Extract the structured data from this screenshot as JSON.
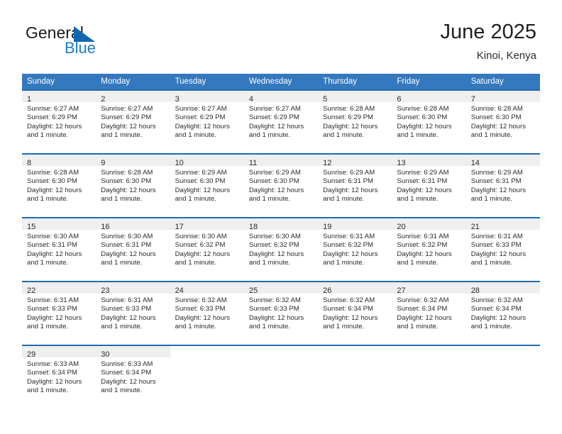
{
  "logo": {
    "word_one": "General",
    "word_two": "Blue",
    "triangle_icon": "triangle-icon",
    "blue_color": "#1f7ac4"
  },
  "header": {
    "title": "June 2025",
    "location": "Kinoi, Kenya"
  },
  "theme": {
    "header_blue": "#3478bd",
    "border_blue": "#1f6cb0",
    "daynum_bg": "#efefef"
  },
  "calendar": {
    "weekday_headers": [
      "Sunday",
      "Monday",
      "Tuesday",
      "Wednesday",
      "Thursday",
      "Friday",
      "Saturday"
    ],
    "weeks": [
      [
        {
          "day": "1",
          "sunrise": "Sunrise: 6:27 AM",
          "sunset": "Sunset: 6:29 PM",
          "daylight": "Daylight: 12 hours and 1 minute."
        },
        {
          "day": "2",
          "sunrise": "Sunrise: 6:27 AM",
          "sunset": "Sunset: 6:29 PM",
          "daylight": "Daylight: 12 hours and 1 minute."
        },
        {
          "day": "3",
          "sunrise": "Sunrise: 6:27 AM",
          "sunset": "Sunset: 6:29 PM",
          "daylight": "Daylight: 12 hours and 1 minute."
        },
        {
          "day": "4",
          "sunrise": "Sunrise: 6:27 AM",
          "sunset": "Sunset: 6:29 PM",
          "daylight": "Daylight: 12 hours and 1 minute."
        },
        {
          "day": "5",
          "sunrise": "Sunrise: 6:28 AM",
          "sunset": "Sunset: 6:29 PM",
          "daylight": "Daylight: 12 hours and 1 minute."
        },
        {
          "day": "6",
          "sunrise": "Sunrise: 6:28 AM",
          "sunset": "Sunset: 6:30 PM",
          "daylight": "Daylight: 12 hours and 1 minute."
        },
        {
          "day": "7",
          "sunrise": "Sunrise: 6:28 AM",
          "sunset": "Sunset: 6:30 PM",
          "daylight": "Daylight: 12 hours and 1 minute."
        }
      ],
      [
        {
          "day": "8",
          "sunrise": "Sunrise: 6:28 AM",
          "sunset": "Sunset: 6:30 PM",
          "daylight": "Daylight: 12 hours and 1 minute."
        },
        {
          "day": "9",
          "sunrise": "Sunrise: 6:28 AM",
          "sunset": "Sunset: 6:30 PM",
          "daylight": "Daylight: 12 hours and 1 minute."
        },
        {
          "day": "10",
          "sunrise": "Sunrise: 6:29 AM",
          "sunset": "Sunset: 6:30 PM",
          "daylight": "Daylight: 12 hours and 1 minute."
        },
        {
          "day": "11",
          "sunrise": "Sunrise: 6:29 AM",
          "sunset": "Sunset: 6:30 PM",
          "daylight": "Daylight: 12 hours and 1 minute."
        },
        {
          "day": "12",
          "sunrise": "Sunrise: 6:29 AM",
          "sunset": "Sunset: 6:31 PM",
          "daylight": "Daylight: 12 hours and 1 minute."
        },
        {
          "day": "13",
          "sunrise": "Sunrise: 6:29 AM",
          "sunset": "Sunset: 6:31 PM",
          "daylight": "Daylight: 12 hours and 1 minute."
        },
        {
          "day": "14",
          "sunrise": "Sunrise: 6:29 AM",
          "sunset": "Sunset: 6:31 PM",
          "daylight": "Daylight: 12 hours and 1 minute."
        }
      ],
      [
        {
          "day": "15",
          "sunrise": "Sunrise: 6:30 AM",
          "sunset": "Sunset: 6:31 PM",
          "daylight": "Daylight: 12 hours and 1 minute."
        },
        {
          "day": "16",
          "sunrise": "Sunrise: 6:30 AM",
          "sunset": "Sunset: 6:31 PM",
          "daylight": "Daylight: 12 hours and 1 minute."
        },
        {
          "day": "17",
          "sunrise": "Sunrise: 6:30 AM",
          "sunset": "Sunset: 6:32 PM",
          "daylight": "Daylight: 12 hours and 1 minute."
        },
        {
          "day": "18",
          "sunrise": "Sunrise: 6:30 AM",
          "sunset": "Sunset: 6:32 PM",
          "daylight": "Daylight: 12 hours and 1 minute."
        },
        {
          "day": "19",
          "sunrise": "Sunrise: 6:31 AM",
          "sunset": "Sunset: 6:32 PM",
          "daylight": "Daylight: 12 hours and 1 minute."
        },
        {
          "day": "20",
          "sunrise": "Sunrise: 6:31 AM",
          "sunset": "Sunset: 6:32 PM",
          "daylight": "Daylight: 12 hours and 1 minute."
        },
        {
          "day": "21",
          "sunrise": "Sunrise: 6:31 AM",
          "sunset": "Sunset: 6:33 PM",
          "daylight": "Daylight: 12 hours and 1 minute."
        }
      ],
      [
        {
          "day": "22",
          "sunrise": "Sunrise: 6:31 AM",
          "sunset": "Sunset: 6:33 PM",
          "daylight": "Daylight: 12 hours and 1 minute."
        },
        {
          "day": "23",
          "sunrise": "Sunrise: 6:31 AM",
          "sunset": "Sunset: 6:33 PM",
          "daylight": "Daylight: 12 hours and 1 minute."
        },
        {
          "day": "24",
          "sunrise": "Sunrise: 6:32 AM",
          "sunset": "Sunset: 6:33 PM",
          "daylight": "Daylight: 12 hours and 1 minute."
        },
        {
          "day": "25",
          "sunrise": "Sunrise: 6:32 AM",
          "sunset": "Sunset: 6:33 PM",
          "daylight": "Daylight: 12 hours and 1 minute."
        },
        {
          "day": "26",
          "sunrise": "Sunrise: 6:32 AM",
          "sunset": "Sunset: 6:34 PM",
          "daylight": "Daylight: 12 hours and 1 minute."
        },
        {
          "day": "27",
          "sunrise": "Sunrise: 6:32 AM",
          "sunset": "Sunset: 6:34 PM",
          "daylight": "Daylight: 12 hours and 1 minute."
        },
        {
          "day": "28",
          "sunrise": "Sunrise: 6:32 AM",
          "sunset": "Sunset: 6:34 PM",
          "daylight": "Daylight: 12 hours and 1 minute."
        }
      ],
      [
        {
          "day": "29",
          "sunrise": "Sunrise: 6:33 AM",
          "sunset": "Sunset: 6:34 PM",
          "daylight": "Daylight: 12 hours and 1 minute."
        },
        {
          "day": "30",
          "sunrise": "Sunrise: 6:33 AM",
          "sunset": "Sunset: 6:34 PM",
          "daylight": "Daylight: 12 hours and 1 minute."
        },
        null,
        null,
        null,
        null,
        null
      ]
    ]
  }
}
